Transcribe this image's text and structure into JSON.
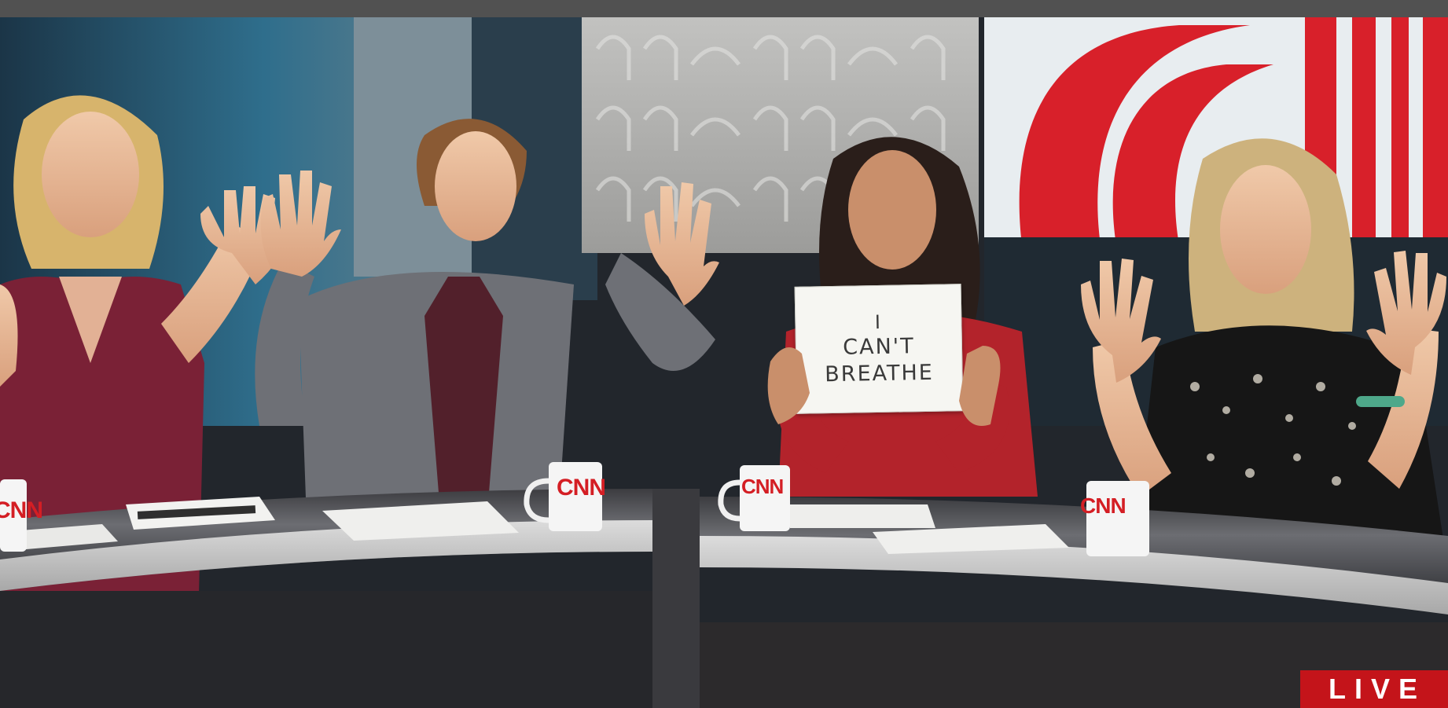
{
  "sign": {
    "line1": "I",
    "line2": "CAN'T",
    "line3": "BREATHE"
  },
  "mugs": {
    "logo_text": "CNN"
  },
  "badge": {
    "live_label": "LIVE"
  },
  "colors": {
    "cnn_red": "#d41e24",
    "live_red": "#c4141a",
    "set_blue": "#2f6e8c"
  },
  "icons": [
    "cnn-logo-icon"
  ]
}
